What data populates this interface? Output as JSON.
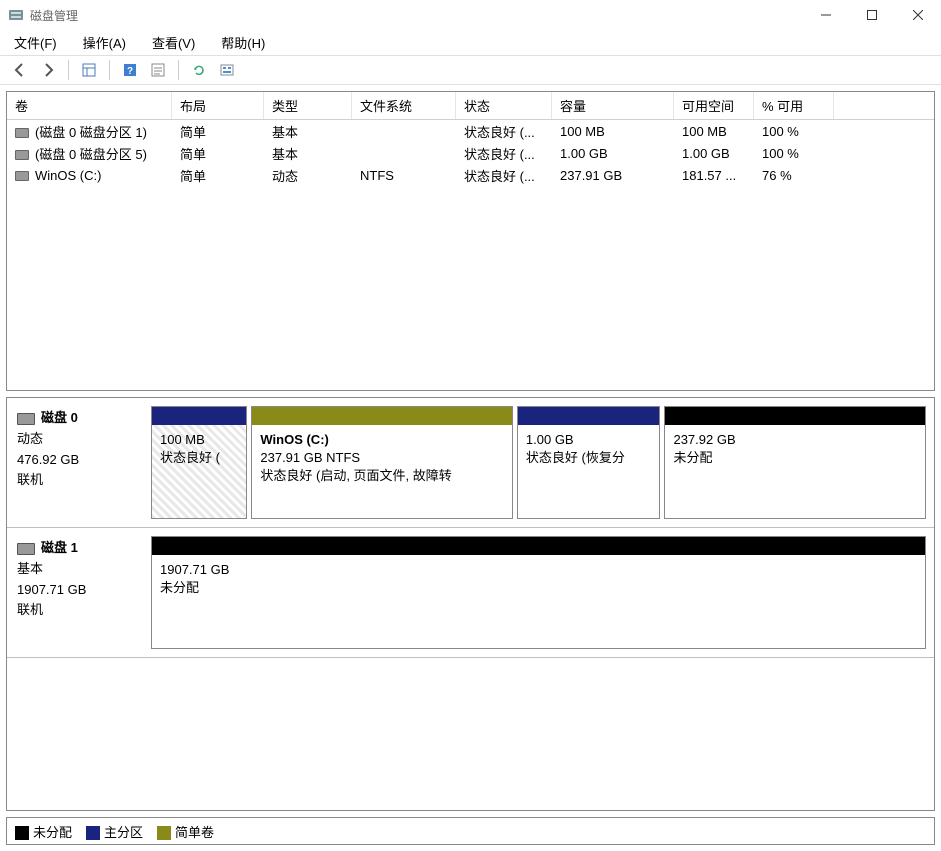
{
  "window": {
    "title": "磁盘管理"
  },
  "menu": {
    "file": "文件(F)",
    "action": "操作(A)",
    "view": "查看(V)",
    "help": "帮助(H)"
  },
  "columns": {
    "volume": "卷",
    "layout": "布局",
    "type": "类型",
    "fs": "文件系统",
    "status": "状态",
    "capacity": "容量",
    "free": "可用空间",
    "pctfree": "% 可用"
  },
  "volumes": [
    {
      "name": "(磁盘 0 磁盘分区 1)",
      "layout": "简单",
      "type": "基本",
      "fs": "",
      "status": "状态良好 (...",
      "capacity": "100 MB",
      "free": "100 MB",
      "pctfree": "100 %"
    },
    {
      "name": "(磁盘 0 磁盘分区 5)",
      "layout": "简单",
      "type": "基本",
      "fs": "",
      "status": "状态良好 (...",
      "capacity": "1.00 GB",
      "free": "1.00 GB",
      "pctfree": "100 %"
    },
    {
      "name": "WinOS (C:)",
      "layout": "简单",
      "type": "动态",
      "fs": "NTFS",
      "status": "状态良好 (...",
      "capacity": "237.91 GB",
      "free": "181.57 ...",
      "pctfree": "76 %"
    }
  ],
  "disks": [
    {
      "name": "磁盘 0",
      "type": "动态",
      "capacity": "476.92 GB",
      "status": "联机",
      "partitions": [
        {
          "title": "",
          "size": "100 MB",
          "detail": "状态良好 (",
          "topClass": "top-blue",
          "flex": 12,
          "hatched": true
        },
        {
          "title": "WinOS  (C:)",
          "size": "237.91 GB NTFS",
          "detail": "状态良好 (启动, 页面文件, 故障转",
          "topClass": "top-olive",
          "flex": 33
        },
        {
          "title": "",
          "size": "1.00 GB",
          "detail": "状态良好 (恢复分",
          "topClass": "top-blue",
          "flex": 18
        },
        {
          "title": "",
          "size": "237.92 GB",
          "detail": "未分配",
          "topClass": "top-black",
          "flex": 33
        }
      ]
    },
    {
      "name": "磁盘 1",
      "type": "基本",
      "capacity": "1907.71 GB",
      "status": "联机",
      "partitions": [
        {
          "title": "",
          "size": "1907.71 GB",
          "detail": "未分配",
          "topClass": "top-black",
          "flex": 100
        }
      ]
    }
  ],
  "legend": {
    "unalloc": "未分配",
    "primary": "主分区",
    "simple": "简单卷"
  }
}
